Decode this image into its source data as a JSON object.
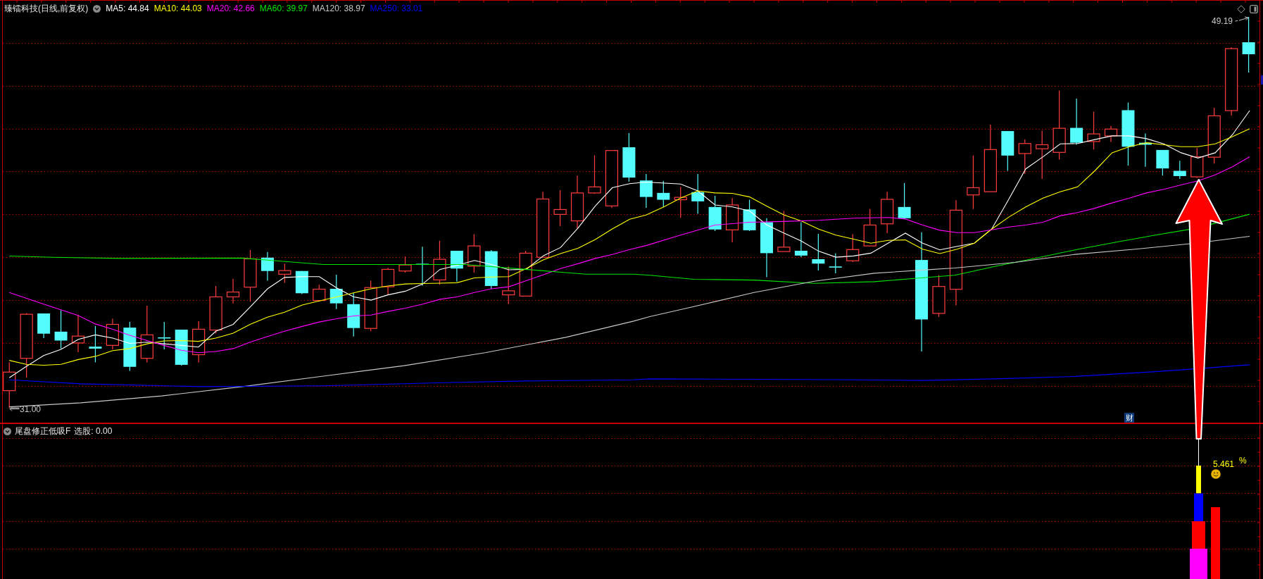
{
  "chart_header": {
    "title": "臻镭科技(日线,前复权)",
    "moving_averages": [
      {
        "label": "MA5: 44.84",
        "color": "#ffffff"
      },
      {
        "label": "MA10: 44.03",
        "color": "#ffff00"
      },
      {
        "label": "MA20: 42.66",
        "color": "#ff00ff"
      },
      {
        "label": "MA60: 39.97",
        "color": "#00e600"
      },
      {
        "label": "MA120: 38.97",
        "color": "#c8c8c8"
      },
      {
        "label": "MA250: 33.01",
        "color": "#0000ff"
      }
    ]
  },
  "price_chart": {
    "high_label": "49.19",
    "low_label": "31.00",
    "event_marker": "财"
  },
  "indicator_pane": {
    "title": "尾盘修正低吸F",
    "reading": "选股: 0.00",
    "value_label": "5.461",
    "unit_label": "%"
  }
}
